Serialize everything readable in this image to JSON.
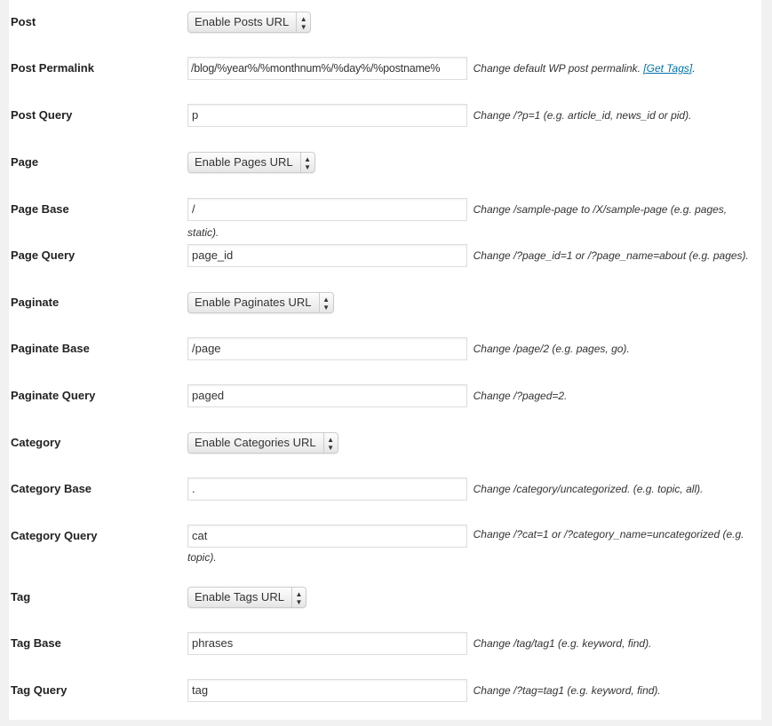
{
  "rows": [
    {
      "label": "Post",
      "type": "select",
      "value": "Enable Posts URL"
    },
    {
      "label": "Post Permalink",
      "type": "text",
      "value": "/blog/%year%/%monthnum%/%day%/%postname%",
      "desc": "Change default WP post permalink. ",
      "link": "[Get Tags]",
      "desc_after": "."
    },
    {
      "label": "Post Query",
      "type": "text",
      "value": "p",
      "desc": "Change /?p=1 (e.g. article_id, news_id or pid)."
    },
    {
      "label": "Page",
      "type": "select",
      "value": "Enable Pages URL"
    },
    {
      "label": "Page Base",
      "type": "text",
      "value": "/",
      "desc": "Change /sample-page to /X/sample-page (e.g. pages, static)."
    },
    {
      "label": "Page Query",
      "type": "text",
      "value": "page_id",
      "desc": "Change /?page_id=1 or /?page_name=about (e.g. pages)."
    },
    {
      "label": "Paginate",
      "type": "select",
      "value": "Enable Paginates URL"
    },
    {
      "label": "Paginate Base",
      "type": "text",
      "value": "/page",
      "desc": "Change /page/2 (e.g. pages, go)."
    },
    {
      "label": "Paginate Query",
      "type": "text",
      "value": "paged",
      "desc": "Change /?paged=2."
    },
    {
      "label": "Category",
      "type": "select",
      "value": "Enable Categories URL"
    },
    {
      "label": "Category Base",
      "type": "text",
      "value": ".",
      "desc": "Change /category/uncategorized. (e.g. topic, all)."
    },
    {
      "label": "Category Query",
      "type": "text",
      "value": "cat",
      "desc": "Change /?cat=1 or /?category_name=uncategorized (e.g. topic)."
    },
    {
      "label": "Tag",
      "type": "select",
      "value": "Enable Tags URL"
    },
    {
      "label": "Tag Base",
      "type": "text",
      "value": "phrases",
      "desc": "Change /tag/tag1 (e.g. keyword, find)."
    },
    {
      "label": "Tag Query",
      "type": "text",
      "value": "tag",
      "desc": "Change /?tag=tag1 (e.g. keyword, find)."
    }
  ],
  "icons": {
    "select_arrow": "up-down-arrows-icon"
  },
  "colors": {
    "link": "#0073aa",
    "background": "#f1f1f1"
  }
}
